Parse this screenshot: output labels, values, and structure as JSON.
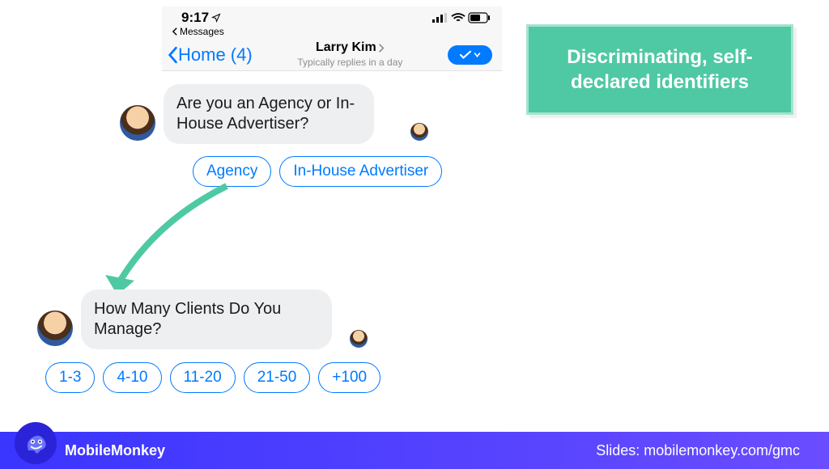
{
  "status": {
    "time": "9:17",
    "back_label": "Messages"
  },
  "header": {
    "home_label": "Home (4)",
    "name": "Larry Kim",
    "subtitle": "Typically replies in a day"
  },
  "chat": {
    "msg1": "Are you an Agency or In-House Advertiser?",
    "replies1": {
      "a": "Agency",
      "b": "In-House Advertiser"
    },
    "msg2": "How Many Clients Do You Manage?",
    "replies2": {
      "a": "1-3",
      "b": "4-10",
      "c": "11-20",
      "d": "21-50",
      "e": "+100"
    }
  },
  "callout": {
    "text": "Discriminating, self-declared identifiers"
  },
  "footer": {
    "brand": "MobileMonkey",
    "slides": "Slides: mobilemonkey.com/gmc"
  }
}
